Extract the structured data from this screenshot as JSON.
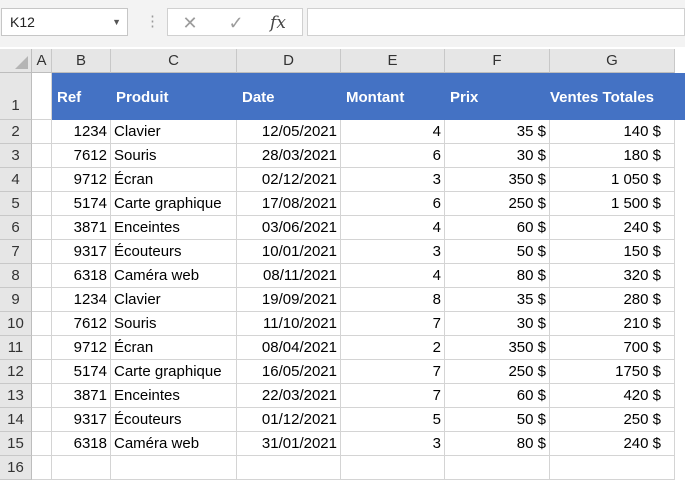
{
  "name_box": {
    "value": "K12"
  },
  "formula_bar": {
    "value": "",
    "fx_label": "fx",
    "cancel_glyph": "✕",
    "enter_glyph": "✓"
  },
  "columns": [
    "A",
    "B",
    "C",
    "D",
    "E",
    "F",
    "G"
  ],
  "rows": [
    "1",
    "2",
    "3",
    "4",
    "5",
    "6",
    "7",
    "8",
    "9",
    "10",
    "11",
    "12",
    "13",
    "14",
    "15",
    "16"
  ],
  "table": {
    "headers": [
      "Ref",
      "Produit",
      "Date",
      "Montant",
      "Prix",
      "Ventes Totales"
    ],
    "rows": [
      [
        "1234",
        "Clavier",
        "12/05/2021",
        "4",
        "35 $",
        "140 $"
      ],
      [
        "7612",
        "Souris",
        "28/03/2021",
        "6",
        "30 $",
        "180 $"
      ],
      [
        "9712",
        "Écran",
        "02/12/2021",
        "3",
        "350 $",
        "1 050 $"
      ],
      [
        "5174",
        "Carte graphique",
        "17/08/2021",
        "6",
        "250 $",
        "1 500 $"
      ],
      [
        "3871",
        "Enceintes",
        "03/06/2021",
        "4",
        "60 $",
        "240 $"
      ],
      [
        "9317",
        "Écouteurs",
        "10/01/2021",
        "3",
        "50 $",
        "150 $"
      ],
      [
        "6318",
        "Caméra web",
        "08/11/2021",
        "4",
        "80 $",
        "320 $"
      ],
      [
        "1234",
        "Clavier",
        "19/09/2021",
        "8",
        "35 $",
        "280 $"
      ],
      [
        "7612",
        "Souris",
        "11/10/2021",
        "7",
        "30 $",
        "210 $"
      ],
      [
        "9712",
        "Écran",
        "08/04/2021",
        "2",
        "350 $",
        "700 $"
      ],
      [
        "5174",
        "Carte graphique",
        "16/05/2021",
        "7",
        "250 $",
        "1750 $"
      ],
      [
        "3871",
        "Enceintes",
        "22/03/2021",
        "7",
        "60 $",
        "420 $"
      ],
      [
        "9317",
        "Écouteurs",
        "01/12/2021",
        "5",
        "50 $",
        "250 $"
      ],
      [
        "6318",
        "Caméra web",
        "31/01/2021",
        "3",
        "80 $",
        "240 $"
      ]
    ]
  },
  "colors": {
    "header_fill": "#4472c4",
    "header_text": "#ffffff",
    "gridline": "#d4d4d4"
  }
}
